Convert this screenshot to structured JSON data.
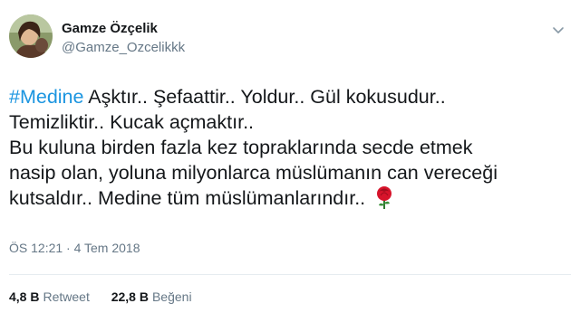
{
  "author": {
    "name": "Gamze Özçelik",
    "handle": "@Gamze_Ozcelikkk"
  },
  "tweet": {
    "hashtag": "#Medine",
    "line1_rest": " Aşktır.. Şefaattir.. Yoldur.. Gül kokusudur..",
    "line2": "Temizliktir.. Kucak açmaktır..",
    "line3": "Bu kuluna birden fazla kez topraklarında secde etmek",
    "line4": "nasip olan, yoluna milyonlarca müslümanın can vereceği",
    "line5": "kutsaldır.. Medine tüm müslümanlarındır..",
    "emoji": "rose-icon"
  },
  "meta": {
    "timestamp": "ÖS 12:21 · 4 Tem 2018"
  },
  "stats": {
    "retweets_count": "4,8 B",
    "retweets_label": "Retweet",
    "likes_count": "22,8 B",
    "likes_label": "Beğeni"
  },
  "colors": {
    "hashtag": "#1b95e0",
    "secondary_text": "#657786",
    "rose": "#d7142b"
  }
}
